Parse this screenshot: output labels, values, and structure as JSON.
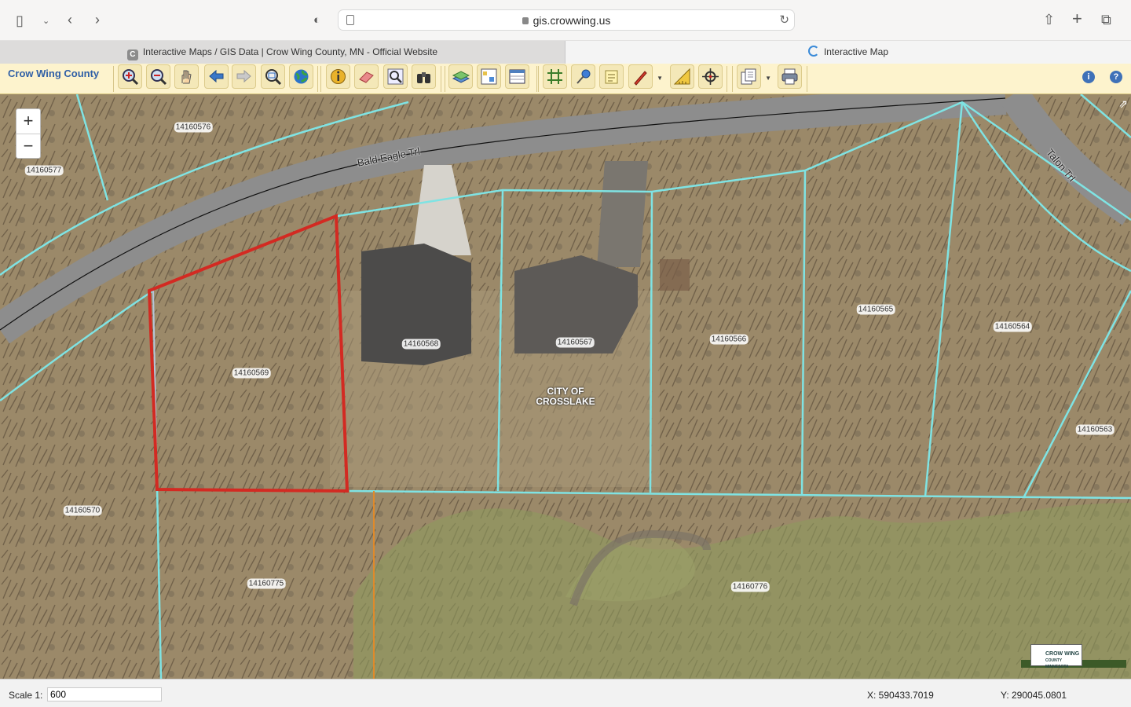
{
  "browser": {
    "url": "gis.crowwing.us",
    "tabs": [
      {
        "label": "Interactive Maps / GIS Data | Crow Wing County, MN - Official Website",
        "favicon": "C"
      },
      {
        "label": "Interactive Map"
      }
    ]
  },
  "toolbar": {
    "brand": "Crow Wing County",
    "tools": [
      {
        "name": "zoom-in-tool-icon"
      },
      {
        "name": "zoom-out-tool-icon"
      },
      {
        "name": "pan-hand-icon"
      },
      {
        "name": "previous-extent-icon"
      },
      {
        "name": "next-extent-icon"
      },
      {
        "name": "zoom-to-extent-icon"
      },
      {
        "name": "full-extent-globe-icon"
      },
      {
        "name": "identify-icon"
      },
      {
        "name": "eraser-icon"
      },
      {
        "name": "search-magnifier-icon"
      },
      {
        "name": "binoculars-icon"
      },
      {
        "name": "layers-icon"
      },
      {
        "name": "legend-icon"
      },
      {
        "name": "table-icon"
      },
      {
        "name": "grid-icon"
      },
      {
        "name": "pushpin-icon"
      },
      {
        "name": "notes-icon"
      },
      {
        "name": "draw-pen-icon"
      },
      {
        "name": "measure-icon"
      },
      {
        "name": "crosshair-icon"
      },
      {
        "name": "print-layout-icon"
      },
      {
        "name": "printer-icon"
      }
    ],
    "info_label": "i",
    "help_label": "?"
  },
  "map": {
    "zoom_in": "+",
    "zoom_out": "−",
    "parcels": [
      "14160576",
      "14160577",
      "14160569",
      "14160568",
      "14160567",
      "14160566",
      "14160565",
      "14160564",
      "14160563",
      "14160570",
      "14160775",
      "14160776"
    ],
    "roads": [
      "Bald Eagle Trl",
      "Talon Trl"
    ],
    "city_label": [
      "CITY OF",
      "CROSSLAKE"
    ],
    "badge_text": [
      "CROW WING",
      "COUNTY",
      "MINNESOTA"
    ],
    "colors": {
      "parcel_line": "#7fe3e3",
      "selected_parcel": "#d32a22",
      "imagery": "#9c8a6c",
      "road": "#8d8d8d"
    }
  },
  "status": {
    "scale_label": "Scale 1:",
    "scale_value": "600",
    "x_coord": "X: 590433.7019",
    "y_coord": "Y: 290045.0801"
  }
}
